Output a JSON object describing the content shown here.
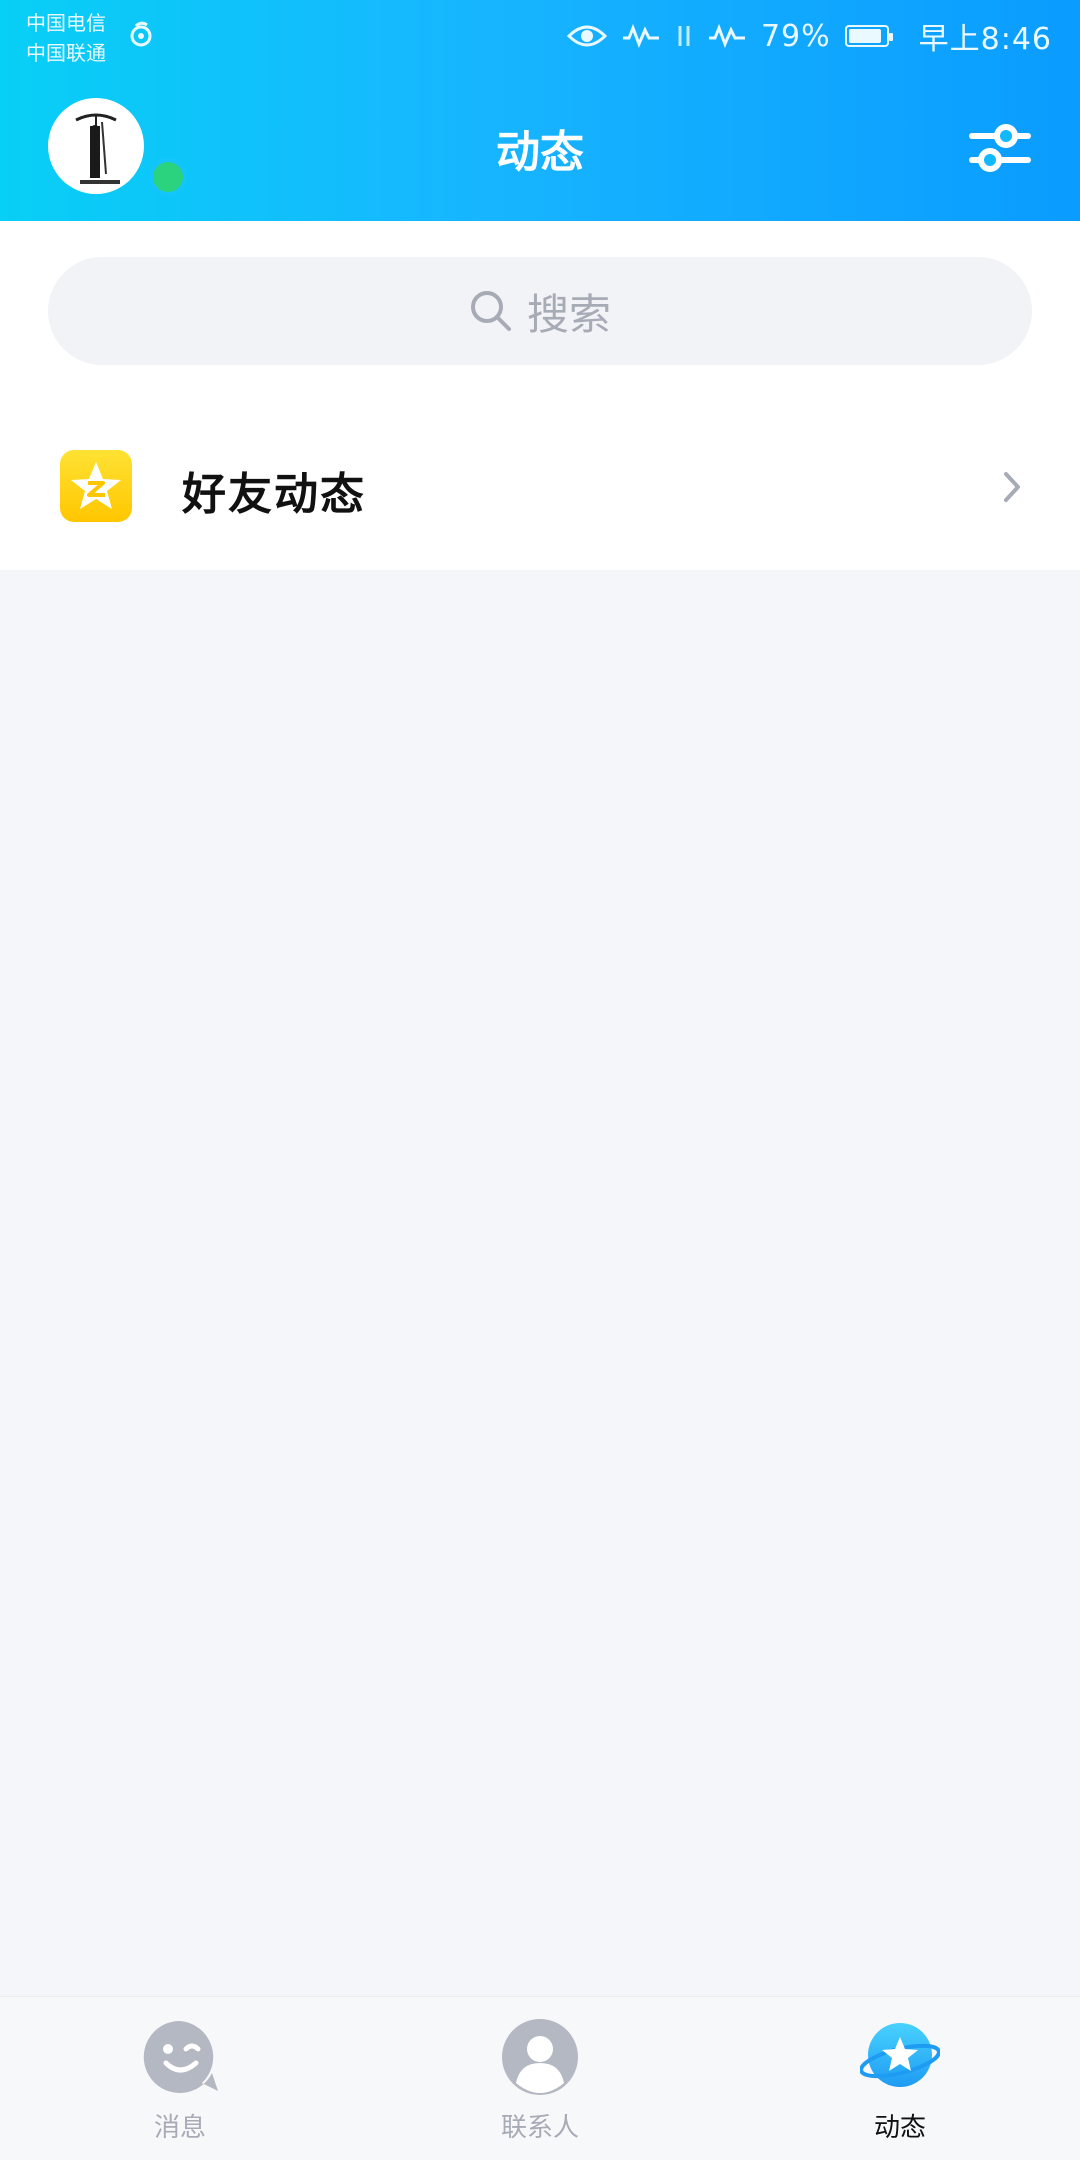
{
  "status_bar": {
    "carrier1": "中国电信",
    "carrier2": "中国联通",
    "battery_text": "79%",
    "time": "早上8:46"
  },
  "header": {
    "title": "动态"
  },
  "search": {
    "label": "搜索"
  },
  "list": {
    "items": [
      {
        "label": "好友动态",
        "icon": "qzone-star-icon"
      }
    ]
  },
  "bottom_nav": {
    "tabs": [
      {
        "label": "消息",
        "icon": "wink-face-icon",
        "active": false
      },
      {
        "label": "联系人",
        "icon": "person-icon",
        "active": false
      },
      {
        "label": "动态",
        "icon": "planet-star-icon",
        "active": true
      }
    ]
  },
  "colors": {
    "header_start": "#08CFF6",
    "header_end": "#0A9CFF",
    "online": "#2BD37E",
    "qzone_yellow": "#FFC600",
    "inactive": "#A7ABB6",
    "background": "#F5F6FA"
  }
}
